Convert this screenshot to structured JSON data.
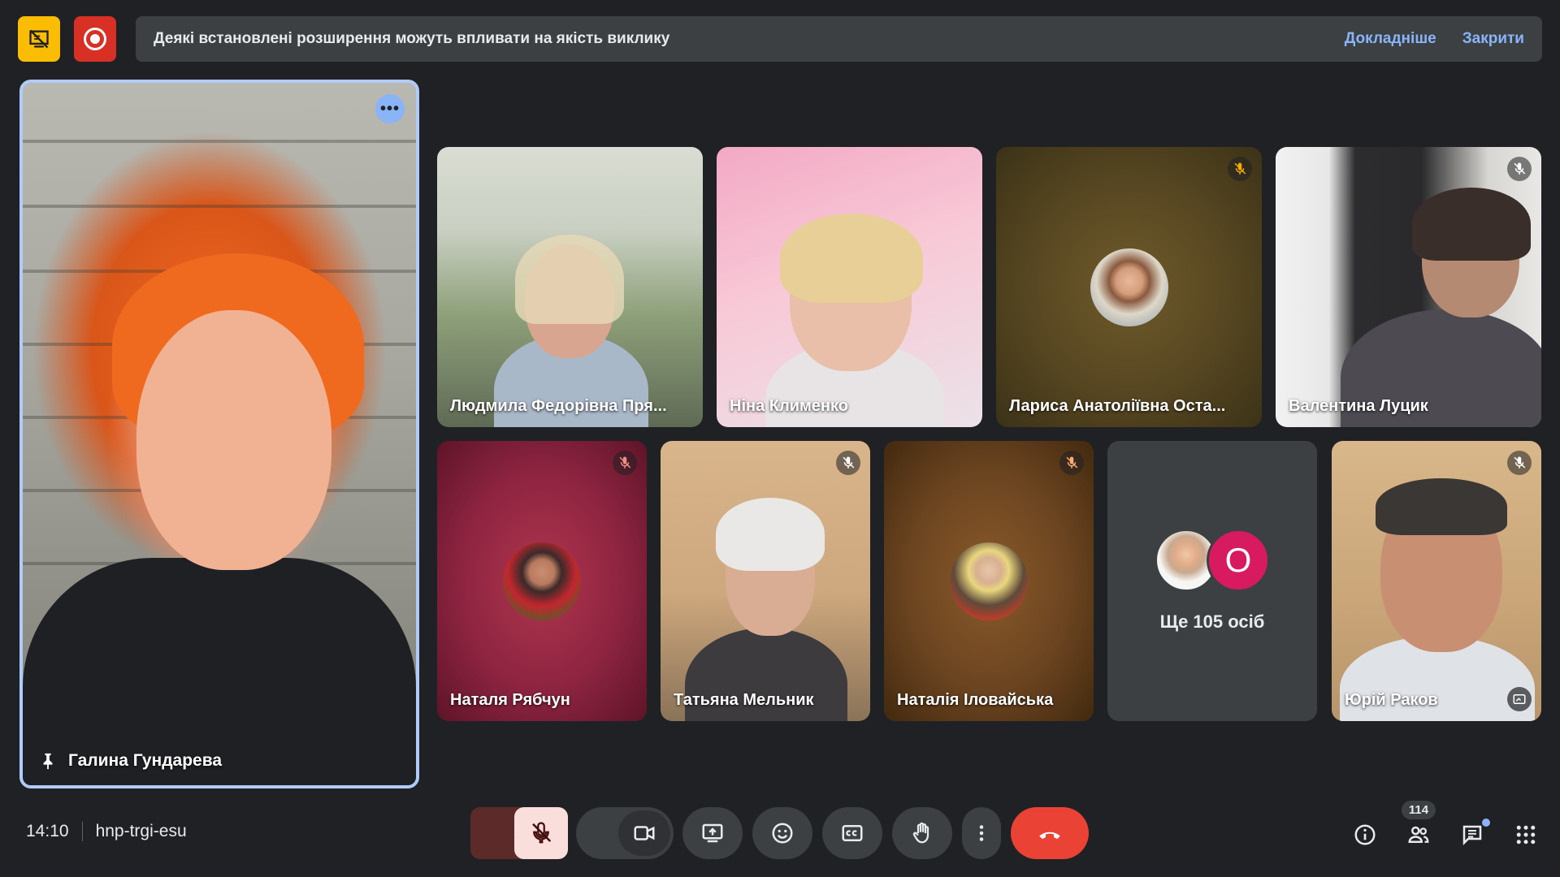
{
  "banner": {
    "message": "Деякі встановлені розширення можуть впливати на якість виклику",
    "learn_more": "Докладніше",
    "close": "Закрити"
  },
  "featured": {
    "name": "Галина Гундарева"
  },
  "tiles": [
    {
      "name": "Людмила Федорівна Пря...",
      "muted": false
    },
    {
      "name": "Ніна Клименко",
      "muted": false
    },
    {
      "name": "Лариса Анатоліївна Оста...",
      "muted": true
    },
    {
      "name": "Валентина Луцик",
      "muted": true
    },
    {
      "name": "Наталя Рябчун",
      "muted": true
    },
    {
      "name": "Татьяна Мельник",
      "muted": true
    },
    {
      "name": "Наталія Іловайська",
      "muted": true
    },
    {
      "name": "Юрій Раков",
      "muted": true
    }
  ],
  "more_people": {
    "initial": "O",
    "label": "Ще 105 осіб"
  },
  "footer": {
    "time": "14:10",
    "meeting_code": "hnp-trgi-esu",
    "participants_count": "114"
  },
  "icons": {
    "tab-icon": "no-sharing",
    "record-icon": "record",
    "mute-icon": "mic-off",
    "pin-icon": "pin"
  },
  "colors": {
    "accent": "#8ab4f8",
    "end_call": "#ea4335",
    "record": "#d93025",
    "warning": "#fbbc04"
  }
}
